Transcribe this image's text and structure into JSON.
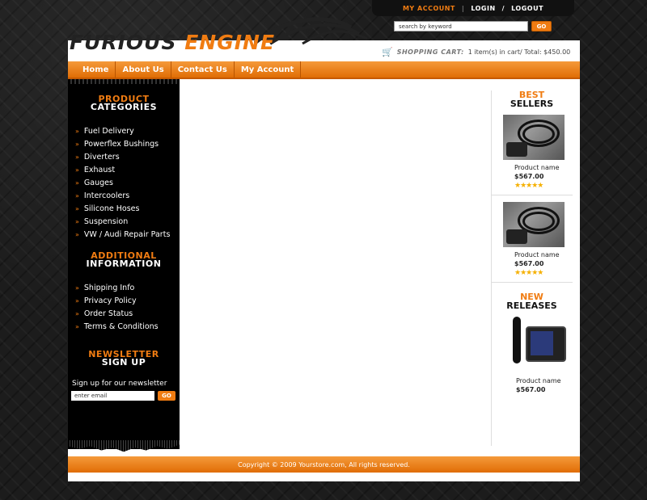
{
  "topbar": {
    "my_account": "MY ACCOUNT",
    "login": "LOGIN",
    "slash": "/",
    "logout": "LOGOUT"
  },
  "search": {
    "placeholder": "search by keyword",
    "value": "search by keyword",
    "go": "GO"
  },
  "logo": {
    "part1": "FURIOUS",
    "part2": "ENGINE"
  },
  "cart": {
    "label": "SHOPPING CART:",
    "summary": "1 item(s) in cart/ Total: $450.00"
  },
  "nav": [
    {
      "label": "Home"
    },
    {
      "label": "About Us"
    },
    {
      "label": "Contact Us"
    },
    {
      "label": "My Account"
    }
  ],
  "sidebar": {
    "categories_title_1": "PRODUCT",
    "categories_title_2": "CATEGORIES",
    "categories": [
      "Fuel Delivery",
      "Powerflex Bushings",
      "Diverters",
      "Exhaust",
      "Gauges",
      "Intercoolers",
      "Silicone Hoses",
      "Suspension",
      "VW / Audi Repair Parts"
    ],
    "info_title_1": "ADDITIONAL",
    "info_title_2": "INFORMATION",
    "info": [
      "Shipping Info",
      "Privacy Policy",
      "Order Status",
      "Terms & Conditions"
    ],
    "newsletter_title_1": "NEWSLETTER",
    "newsletter_title_2": "SIGN UP",
    "newsletter_text": "Sign up for our newsletter",
    "newsletter_placeholder": "enter email",
    "newsletter_value": "enter email",
    "newsletter_go": "GO"
  },
  "right": {
    "best_title_1": "BEST",
    "best_title_2": "SELLERS",
    "best": [
      {
        "name": "Product name",
        "price": "$567.00",
        "stars": "★★★★★"
      },
      {
        "name": "Product name",
        "price": "$567.00",
        "stars": "★★★★★"
      }
    ],
    "new_title_1": "NEW",
    "new_title_2": "RELEASES",
    "new_product": {
      "name": "Product name",
      "price": "$567.00"
    }
  },
  "footer": {
    "text": "Copyright © 2009 Yourstore.com, All rights reserved."
  },
  "colors": {
    "accent": "#f07c12",
    "dark": "#000000",
    "panel": "#ffffff"
  }
}
